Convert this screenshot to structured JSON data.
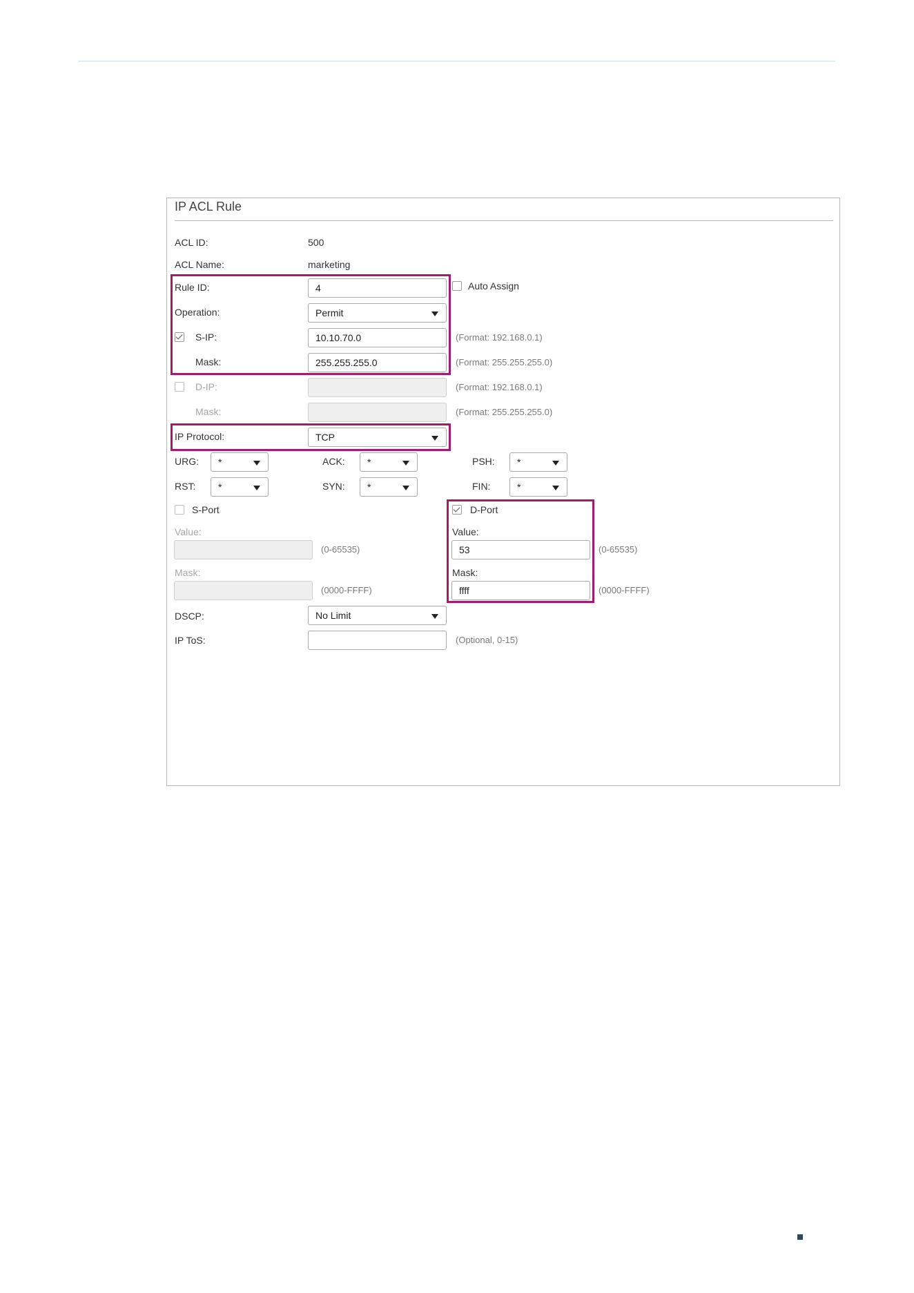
{
  "panel": {
    "title": "IP ACL Rule"
  },
  "acl": {
    "id_label": "ACL ID:",
    "id_value": "500",
    "name_label": "ACL Name:",
    "name_value": "marketing"
  },
  "rule": {
    "id_label": "Rule ID:",
    "id_value": "4",
    "auto_assign_label": "Auto Assign",
    "auto_assign_checked": false,
    "operation_label": "Operation:",
    "operation_value": "Permit"
  },
  "sip": {
    "label": "S-IP:",
    "checked": true,
    "value": "10.10.70.0",
    "hint": "(Format: 192.168.0.1)",
    "mask_label": "Mask:",
    "mask_value": "255.255.255.0",
    "mask_hint": "(Format: 255.255.255.0)"
  },
  "dip": {
    "label": "D-IP:",
    "checked": false,
    "value": "",
    "hint": "(Format: 192.168.0.1)",
    "mask_label": "Mask:",
    "mask_value": "",
    "mask_hint": "(Format: 255.255.255.0)"
  },
  "protocol": {
    "label": "IP Protocol:",
    "value": "TCP"
  },
  "flags": [
    {
      "label": "URG:",
      "value": "*"
    },
    {
      "label": "ACK:",
      "value": "*"
    },
    {
      "label": "PSH:",
      "value": "*"
    },
    {
      "label": "RST:",
      "value": "*"
    },
    {
      "label": "SYN:",
      "value": "*"
    },
    {
      "label": "FIN:",
      "value": "*"
    }
  ],
  "sport": {
    "label": "S-Port",
    "checked": false,
    "value_label": "Value:",
    "value": "",
    "value_hint": "(0-65535)",
    "mask_label": "Mask:",
    "mask_value": "",
    "mask_hint": "(0000-FFFF)"
  },
  "dport": {
    "label": "D-Port",
    "checked": true,
    "value_label": "Value:",
    "value": "53",
    "value_hint": "(0-65535)",
    "mask_label": "Mask:",
    "mask_value": "ffff",
    "mask_hint": "(0000-FFFF)"
  },
  "dscp": {
    "label": "DSCP:",
    "value": "No Limit"
  },
  "tos": {
    "label": "IP ToS:",
    "value": "",
    "hint": "(Optional, 0-15)"
  },
  "colors": {
    "highlight": "#a51a6a",
    "page_mark": "#2d4a5a"
  }
}
